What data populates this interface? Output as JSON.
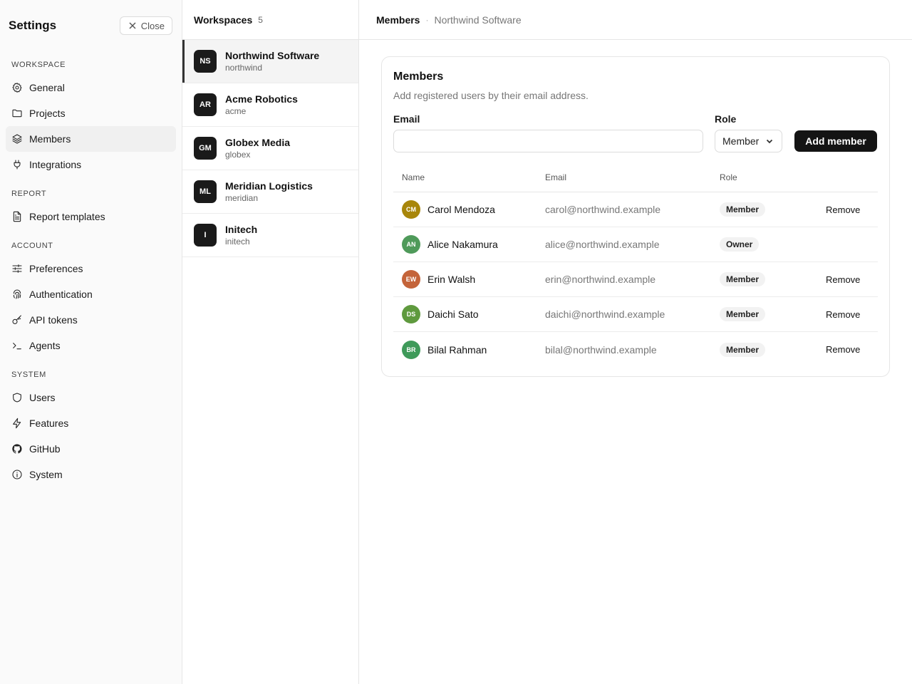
{
  "sidebar": {
    "title": "Settings",
    "close_label": "Close",
    "sections": [
      {
        "label": "WORKSPACE",
        "items": [
          {
            "label": "General",
            "icon": "gear-icon"
          },
          {
            "label": "Projects",
            "icon": "folder-icon"
          },
          {
            "label": "Members",
            "icon": "layers-icon",
            "active": true
          },
          {
            "label": "Integrations",
            "icon": "plug-icon"
          }
        ]
      },
      {
        "label": "REPORT",
        "items": [
          {
            "label": "Report templates",
            "icon": "file-text-icon"
          }
        ]
      },
      {
        "label": "ACCOUNT",
        "items": [
          {
            "label": "Preferences",
            "icon": "sliders-icon"
          },
          {
            "label": "Authentication",
            "icon": "fingerprint-icon"
          },
          {
            "label": "API tokens",
            "icon": "key-icon"
          },
          {
            "label": "Agents",
            "icon": "terminal-icon"
          }
        ]
      },
      {
        "label": "SYSTEM",
        "items": [
          {
            "label": "Users",
            "icon": "shield-icon"
          },
          {
            "label": "Features",
            "icon": "zap-icon"
          },
          {
            "label": "GitHub",
            "icon": "github-icon"
          },
          {
            "label": "System",
            "icon": "info-icon"
          }
        ]
      }
    ]
  },
  "workspaces": {
    "title": "Workspaces",
    "count": "5",
    "items": [
      {
        "initials": "NS",
        "name": "Northwind Software",
        "slug": "northwind",
        "active": true
      },
      {
        "initials": "AR",
        "name": "Acme Robotics",
        "slug": "acme"
      },
      {
        "initials": "GM",
        "name": "Globex Media",
        "slug": "globex"
      },
      {
        "initials": "ML",
        "name": "Meridian Logistics",
        "slug": "meridian"
      },
      {
        "initials": "I",
        "name": "Initech",
        "slug": "initech"
      }
    ]
  },
  "main": {
    "breadcrumb_current": "Members",
    "breadcrumb_sep": "·",
    "breadcrumb_parent": "Northwind Software"
  },
  "card": {
    "title": "Members",
    "description": "Add registered users by their email address.",
    "email_label": "Email",
    "email_value": "",
    "email_placeholder": "",
    "role_label": "Role",
    "role_value": "Member",
    "add_label": "Add member",
    "columns": {
      "name": "Name",
      "email": "Email",
      "role": "Role"
    },
    "members": [
      {
        "initials": "CM",
        "name": "Carol Mendoza",
        "email": "carol@northwind.example",
        "role": "Member",
        "action": "Remove",
        "color": "#a8860b"
      },
      {
        "initials": "AN",
        "name": "Alice Nakamura",
        "email": "alice@northwind.example",
        "role": "Owner",
        "action": "",
        "color": "#4f9a5a"
      },
      {
        "initials": "EW",
        "name": "Erin Walsh",
        "email": "erin@northwind.example",
        "role": "Member",
        "action": "Remove",
        "color": "#c4643a"
      },
      {
        "initials": "DS",
        "name": "Daichi Sato",
        "email": "daichi@northwind.example",
        "role": "Member",
        "action": "Remove",
        "color": "#5f9a3e"
      },
      {
        "initials": "BR",
        "name": "Bilal Rahman",
        "email": "bilal@northwind.example",
        "role": "Member",
        "action": "Remove",
        "color": "#3f9a5a"
      }
    ]
  }
}
